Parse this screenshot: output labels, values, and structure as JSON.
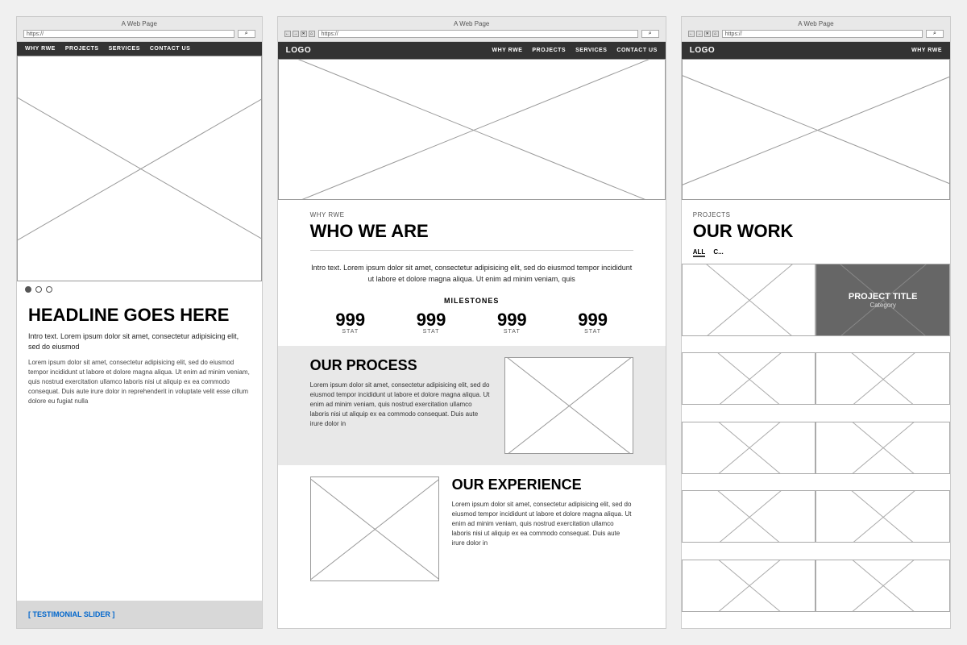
{
  "app_title": "A Web Page",
  "url": "https://",
  "panels": {
    "panel1": {
      "nav": {
        "items": [
          "WHY RWE",
          "PROJECTS",
          "SERVICES",
          "CONTACT US"
        ]
      },
      "dots": [
        true,
        false,
        false
      ],
      "headline": "HEADLINE GOES HERE",
      "intro": "Intro text. Lorem ipsum dolor sit amet, consectetur adipisicing elit, sed do eiusmod",
      "body": "Lorem ipsum dolor sit amet, consectetur adipisicing elit, sed do eiusmod tempor incididunt ut labore et dolore magna aliqua. Ut enim ad minim veniam, quis nostrud exercitation ullamco laboris nisi ut aliquip ex ea commodo consequat. Duis aute irure dolor in reprehenderit in voluptate velit esse cillum dolore eu fugiat nulla",
      "testimonial_label": "[ TESTIMONIAL SLIDER ]"
    },
    "panel2": {
      "logo": "LOGO",
      "nav": {
        "items": [
          "WHY RWE",
          "PROJECTS",
          "SERVICES",
          "CONTACT US"
        ]
      },
      "who": {
        "section_label": "WHY RWE",
        "title": "WHO WE ARE",
        "intro": "Intro text. Lorem ipsum dolor sit amet, consectetur adipisicing elit, sed do eiusmod tempor incididunt ut labore et dolore magna aliqua. Ut enim ad minim veniam, quis"
      },
      "milestones": {
        "title": "MILESTONES",
        "stats": [
          {
            "number": "999",
            "label": "STAT"
          },
          {
            "number": "999",
            "label": "STAT"
          },
          {
            "number": "999",
            "label": "STAT"
          },
          {
            "number": "999",
            "label": "STAT"
          }
        ]
      },
      "process": {
        "title": "OUR PROCESS",
        "body": "Lorem ipsum dolor sit amet, consectetur adipisicing elit, sed do eiusmod tempor incididunt ut labore et dolore magna aliqua. Ut enim ad minim veniam, quis nostrud exercitation ullamco laboris nisi ut aliquip ex ea commodo consequat. Duis aute irure dolor in"
      },
      "experience": {
        "title": "OUR EXPERIENCE",
        "body": "Lorem ipsum dolor sit amet, consectetur adipisicing elit, sed do eiusmod tempor incididunt ut labore et dolore magna aliqua. Ut enim ad minim veniam, quis nostrud exercitation ullamco laboris nisi ut aliquip ex ea commodo consequat. Duis aute irure dolor in"
      }
    },
    "panel3": {
      "logo": "LOGO",
      "nav": {
        "items": [
          "WHY RWE"
        ]
      },
      "projects": {
        "section_label": "PROJECTS",
        "title": "OUR WORK",
        "filters": [
          "ALL",
          "C..."
        ],
        "featured_project": {
          "title": "PROJECT TITLE",
          "category": "Category"
        }
      }
    }
  }
}
